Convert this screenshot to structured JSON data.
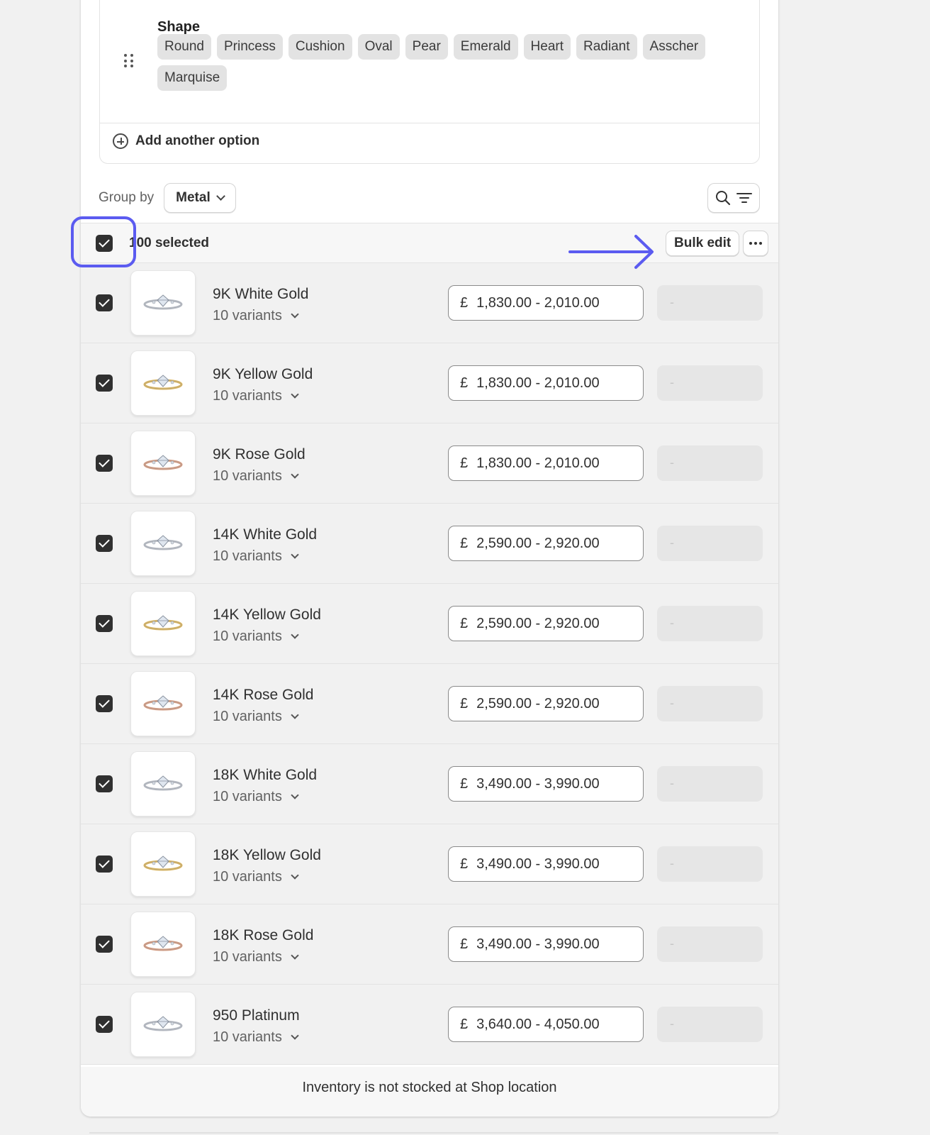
{
  "options": {
    "shape_label": "Shape",
    "shape_values": [
      "Round",
      "Princess",
      "Cushion",
      "Oval",
      "Pear",
      "Emerald",
      "Heart",
      "Radiant",
      "Asscher",
      "Marquise"
    ],
    "add_option_label": "Add another option"
  },
  "toolbar": {
    "group_by_label": "Group by",
    "group_by_value": "Metal"
  },
  "selection": {
    "selected_text": "100 selected",
    "bulk_edit_label": "Bulk edit"
  },
  "rows": [
    {
      "title": "9K White Gold",
      "variants": "10 variants",
      "currency": "£",
      "price": "1,830.00 - 2,010.00",
      "qty": "-",
      "metal": "white"
    },
    {
      "title": "9K Yellow Gold",
      "variants": "10 variants",
      "currency": "£",
      "price": "1,830.00 - 2,010.00",
      "qty": "-",
      "metal": "yellow"
    },
    {
      "title": "9K Rose Gold",
      "variants": "10 variants",
      "currency": "£",
      "price": "1,830.00 - 2,010.00",
      "qty": "-",
      "metal": "rose"
    },
    {
      "title": "14K White Gold",
      "variants": "10 variants",
      "currency": "£",
      "price": "2,590.00 - 2,920.00",
      "qty": "-",
      "metal": "white"
    },
    {
      "title": "14K Yellow Gold",
      "variants": "10 variants",
      "currency": "£",
      "price": "2,590.00 - 2,920.00",
      "qty": "-",
      "metal": "yellow"
    },
    {
      "title": "14K Rose Gold",
      "variants": "10 variants",
      "currency": "£",
      "price": "2,590.00 - 2,920.00",
      "qty": "-",
      "metal": "rose"
    },
    {
      "title": "18K White Gold",
      "variants": "10 variants",
      "currency": "£",
      "price": "3,490.00 - 3,990.00",
      "qty": "-",
      "metal": "white"
    },
    {
      "title": "18K Yellow Gold",
      "variants": "10 variants",
      "currency": "£",
      "price": "3,490.00 - 3,990.00",
      "qty": "-",
      "metal": "yellow"
    },
    {
      "title": "18K Rose Gold",
      "variants": "10 variants",
      "currency": "£",
      "price": "3,490.00 - 3,990.00",
      "qty": "-",
      "metal": "rose"
    },
    {
      "title": "950 Platinum",
      "variants": "10 variants",
      "currency": "£",
      "price": "3,640.00 - 4,050.00",
      "qty": "-",
      "metal": "white"
    }
  ],
  "footer": {
    "text": "Inventory is not stocked at Shop location"
  },
  "colors": {
    "annotation": "#5b5bf0",
    "white_metal": "#b8bcc4",
    "yellow_metal": "#d9b35c",
    "rose_metal": "#d39a7f"
  },
  "icons": {
    "drag": "drag-handle-icon",
    "add": "plus-circle-icon",
    "search": "search-icon",
    "filter": "filter-icon",
    "more": "more-horizontal-icon",
    "chevron": "chevron-down-icon"
  }
}
